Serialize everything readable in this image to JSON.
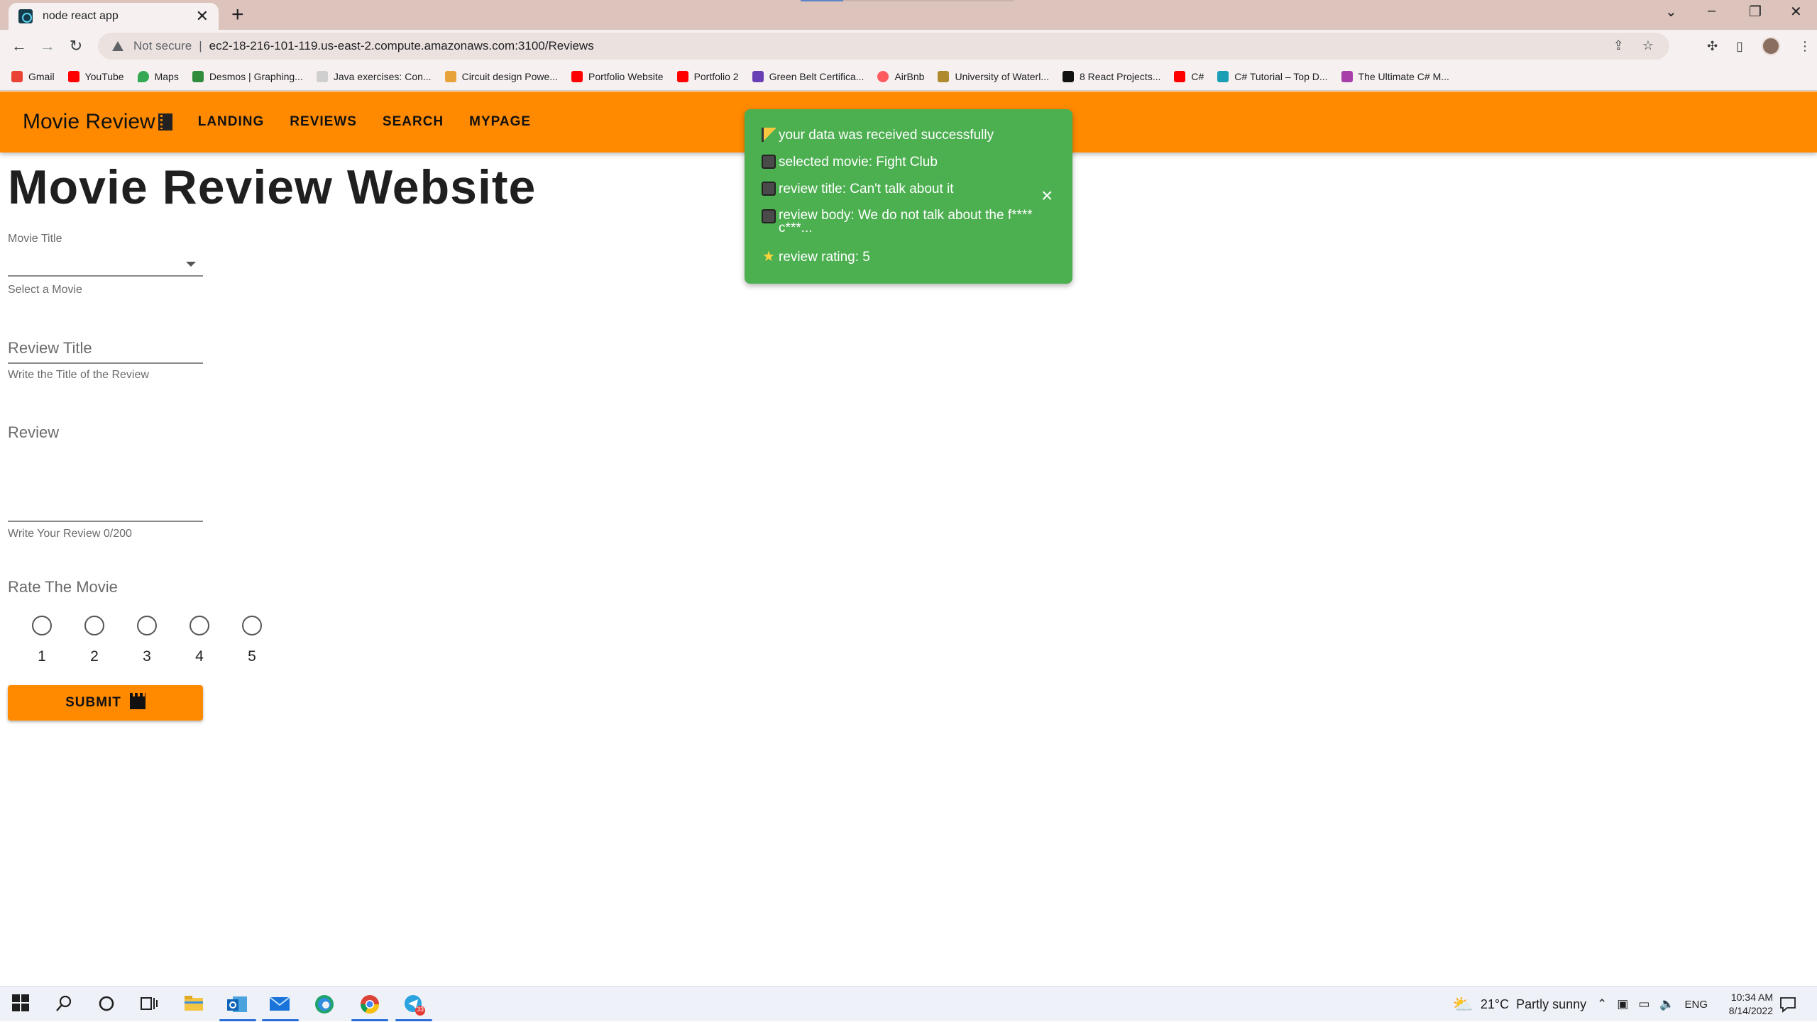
{
  "browser": {
    "tab_title": "node react app",
    "not_secure": "Not secure",
    "url_separator": "|",
    "url": "ec2-18-216-101-119.us-east-2.compute.amazonaws.com:3100/Reviews",
    "bookmarks": [
      {
        "label": "Gmail",
        "color": "#ea4335"
      },
      {
        "label": "YouTube",
        "color": "#ff0000"
      },
      {
        "label": "Maps",
        "color": "#34a853"
      },
      {
        "label": "Desmos | Graphing...",
        "color": "#2f8c3c"
      },
      {
        "label": "Java exercises: Con...",
        "color": "#9e9e9e"
      },
      {
        "label": "Circuit design Powe...",
        "color": "#e8a23a"
      },
      {
        "label": "Portfolio Website",
        "color": "#ff0000"
      },
      {
        "label": "Portfolio 2",
        "color": "#ff0000"
      },
      {
        "label": "Green Belt Certifica...",
        "color": "#6a3fb5"
      },
      {
        "label": "AirBnb",
        "color": "#ff5a5f"
      },
      {
        "label": "University of Waterl...",
        "color": "#b08a2e"
      },
      {
        "label": "8 React Projects...",
        "color": "#111111"
      },
      {
        "label": "C#",
        "color": "#ff0000"
      },
      {
        "label": "C# Tutorial – Top D...",
        "color": "#1a9fb5"
      },
      {
        "label": "The Ultimate C# M...",
        "color": "#a83fa8"
      }
    ]
  },
  "app": {
    "brand": "Movie Review",
    "nav": [
      "LANDING",
      "REVIEWS",
      "SEARCH",
      "MYPAGE"
    ],
    "page_title": "Movie Review Website",
    "form": {
      "movie_label": "Movie Title",
      "movie_helper": "Select a Movie",
      "review_title_placeholder": "Review Title",
      "review_title_helper": "Write the Title of the Review",
      "review_placeholder": "Review",
      "review_helper": "Write Your Review 0/200",
      "rate_label": "Rate The Movie",
      "ratings": [
        "1",
        "2",
        "3",
        "4",
        "5"
      ],
      "submit_label": "SUBMIT"
    },
    "toast": {
      "line1": "your data was received successfully",
      "line2": "selected movie: Fight Club",
      "line3": "review title: Can't talk about it",
      "line4": "review body: We do not talk about the f**** c***...",
      "line5": "review rating: 5",
      "close": "×"
    }
  },
  "taskbar": {
    "weather_temp": "21°C",
    "weather_text": "Partly sunny",
    "lang": "ENG",
    "time": "10:34 AM",
    "date": "8/14/2022",
    "telegram_badge": "33"
  }
}
